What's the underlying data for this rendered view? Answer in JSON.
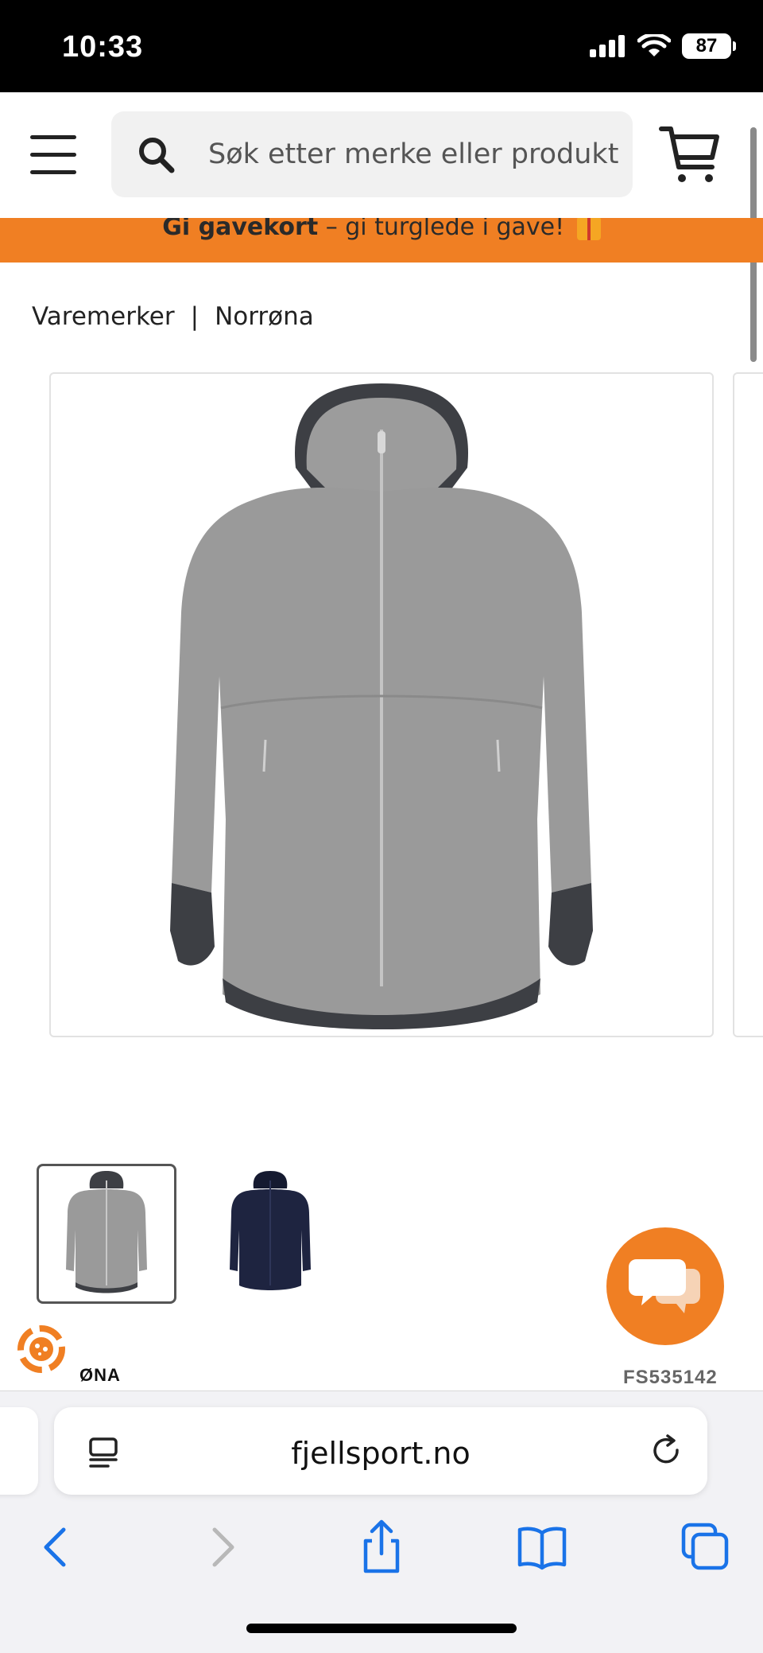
{
  "status_bar": {
    "time": "10:33",
    "battery": "87"
  },
  "header": {
    "search": {
      "placeholder": "Søk etter merke eller produkt",
      "value": ""
    }
  },
  "promo": {
    "strong": "Gi gavekort",
    "text": " – gi turglede i gave! "
  },
  "breadcrumb": {
    "items": [
      "Varemerker",
      "Norrøna"
    ],
    "separator": "|"
  },
  "product": {
    "images": [
      {
        "icon": "grey-wool-hoodie-jacket",
        "selected": true
      },
      {
        "icon": "navy-wool-hoodie-jacket",
        "selected": false
      }
    ],
    "sku": "FS535142",
    "brand_logo": "ØNA"
  },
  "browser": {
    "url": "fjellsport.no"
  },
  "colors": {
    "accent": "#f07f23",
    "ios_blue": "#1a73e8",
    "jacket_grey": "#9a9a9a",
    "jacket_navy": "#1e2440"
  }
}
